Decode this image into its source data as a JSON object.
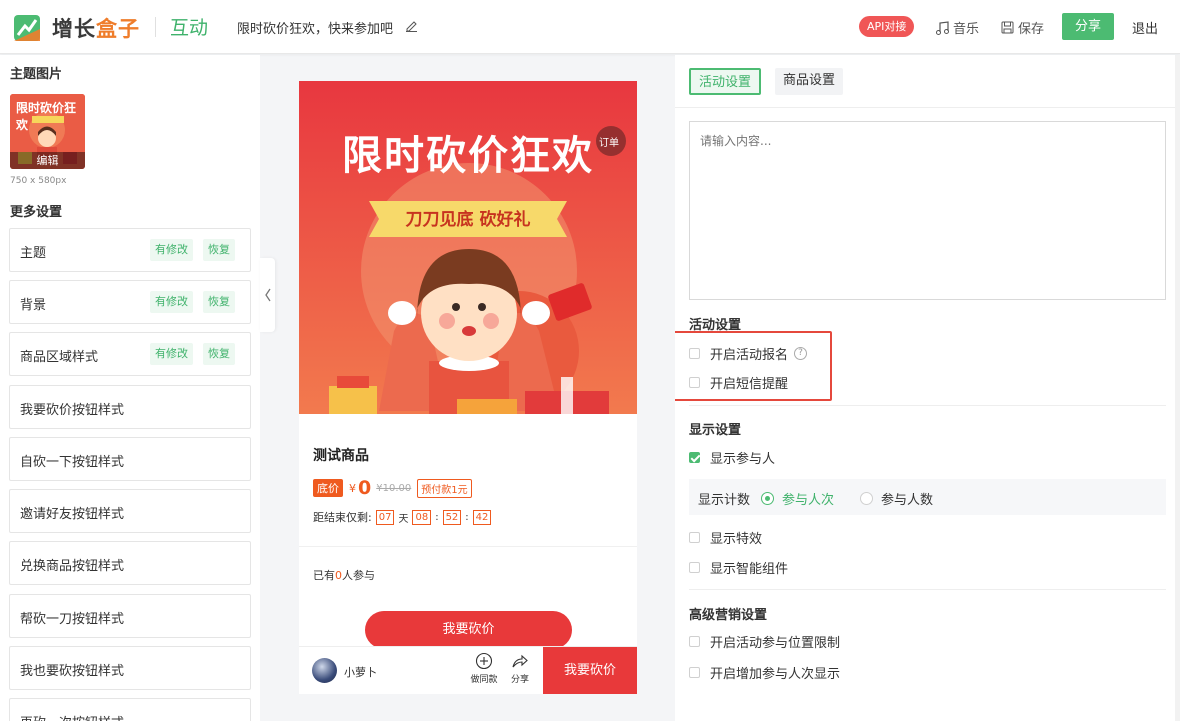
{
  "header": {
    "logo_main": "增长",
    "logo_highlight": "盒子",
    "module": "互动",
    "activity_title": "限时砍价狂欢，快来参加吧",
    "api_badge": "API对接",
    "music_label": "音乐",
    "save_label": "保存",
    "share_label": "分享",
    "exit_label": "退出"
  },
  "left": {
    "theme_image_title": "主题图片",
    "edit_label": "编辑",
    "image_size": "750 x 580px",
    "more_settings_title": "更多设置",
    "modified_tag": "有修改",
    "restore_tag": "恢复",
    "items": [
      {
        "label": "主题",
        "modified": true
      },
      {
        "label": "背景",
        "modified": true
      },
      {
        "label": "商品区域样式",
        "modified": true
      },
      {
        "label": "我要砍价按钮样式",
        "modified": false
      },
      {
        "label": "自砍一下按钮样式",
        "modified": false
      },
      {
        "label": "邀请好友按钮样式",
        "modified": false
      },
      {
        "label": "兑换商品按钮样式",
        "modified": false
      },
      {
        "label": "帮砍一刀按钮样式",
        "modified": false
      },
      {
        "label": "我也要砍按钮样式",
        "modified": false
      },
      {
        "label": "再砍一次按钮样式",
        "modified": false
      }
    ]
  },
  "preview": {
    "banner_title": "限时砍价狂欢",
    "banner_subtitle": "刀刀见底 砍好礼",
    "order_badge": "订单",
    "thumb_title": "限时砍价狂欢",
    "product_name": "测试商品",
    "floor_price_tag": "底价",
    "currency": "¥",
    "price": "0",
    "original_price": "¥10.00",
    "prepay_tag": "预付款1元",
    "countdown_label": "距结束仅剩:",
    "cd_days": "07",
    "cd_day_unit": "天",
    "cd_hours": "08",
    "cd_minutes": "52",
    "cd_seconds": "42",
    "joined_prefix": "已有",
    "joined_count": "0",
    "joined_suffix": "人参与",
    "bargain_button": "我要砍价",
    "shop_name": "小萝卜",
    "make_same_label": "做同款",
    "share_label": "分享",
    "bottom_cta": "我要砍价"
  },
  "right": {
    "tabs": [
      "活动设置",
      "商品设置"
    ],
    "textarea_placeholder": "请输入内容...",
    "activity_settings_title": "活动设置",
    "enable_signup": "开启活动报名",
    "enable_sms": "开启短信提醒",
    "display_settings_title": "显示设置",
    "show_participants": "显示参与人",
    "count_label": "显示计数",
    "count_opt1": "参与人次",
    "count_opt2": "参与人数",
    "show_effects": "显示特效",
    "show_smart": "显示智能组件",
    "advanced_title": "高级营销设置",
    "location_limit": "开启活动参与位置限制",
    "add_count_display": "开启增加参与人次显示"
  },
  "colors": {
    "brand_green": "#4cbb72",
    "accent_orange": "#ef7d2b",
    "price_red": "#ef5a1f",
    "cta_red": "#e8393a"
  }
}
